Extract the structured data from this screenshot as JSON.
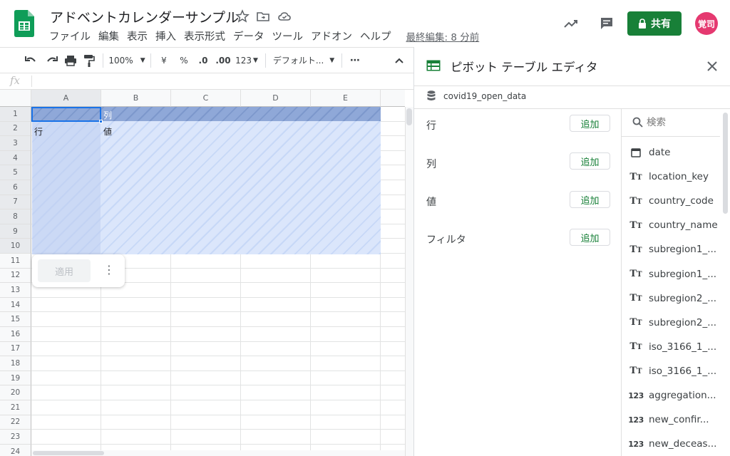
{
  "header": {
    "doc_title": "アドベントカレンダーサンプル",
    "menu": [
      "ファイル",
      "編集",
      "表示",
      "挿入",
      "表示形式",
      "データ",
      "ツール",
      "アドオン",
      "ヘルプ"
    ],
    "last_edit": "最終編集: 8 分前",
    "share_label": "共有",
    "avatar_text": "覚司"
  },
  "toolbar": {
    "zoom": "100%",
    "currency": "¥",
    "percent": "%",
    "dec_less": ".0",
    "dec_more": ".00",
    "format_123": "123",
    "font": "デフォルト..."
  },
  "grid": {
    "columns": [
      "A",
      "B",
      "C",
      "D",
      "E"
    ],
    "rows": [
      "1",
      "2",
      "3",
      "4",
      "5",
      "6",
      "7",
      "8",
      "9",
      "10",
      "11",
      "12",
      "13",
      "14",
      "15",
      "16",
      "17",
      "18",
      "19",
      "20",
      "21",
      "22",
      "23",
      "24"
    ],
    "cell_b1": "列",
    "cell_a2": "行",
    "cell_b2": "値",
    "apply_label": "適用"
  },
  "panel": {
    "title": "ピボット テーブル エディタ",
    "data_source": "covid19_open_data",
    "sections": [
      {
        "label": "行",
        "button": "追加"
      },
      {
        "label": "列",
        "button": "追加"
      },
      {
        "label": "値",
        "button": "追加"
      },
      {
        "label": "フィルタ",
        "button": "追加"
      }
    ],
    "search_placeholder": "検索",
    "fields": [
      {
        "icon": "calendar-icon",
        "label": "date"
      },
      {
        "icon": "text-type-icon",
        "label": "location_key"
      },
      {
        "icon": "text-type-icon",
        "label": "country_code"
      },
      {
        "icon": "text-type-icon",
        "label": "country_name"
      },
      {
        "icon": "text-type-icon",
        "label": "subregion1_..."
      },
      {
        "icon": "text-type-icon",
        "label": "subregion1_..."
      },
      {
        "icon": "text-type-icon",
        "label": "subregion2_..."
      },
      {
        "icon": "text-type-icon",
        "label": "subregion2_..."
      },
      {
        "icon": "text-type-icon",
        "label": "iso_3166_1_..."
      },
      {
        "icon": "text-type-icon",
        "label": "iso_3166_1_..."
      },
      {
        "icon": "number-type-icon",
        "label": "aggregation..."
      },
      {
        "icon": "number-type-icon",
        "label": "new_confir..."
      },
      {
        "icon": "number-type-icon",
        "label": "new_deceas..."
      }
    ]
  },
  "colors": {
    "brand_green": "#188038",
    "avatar_pink": "#e53970",
    "pivot_fill": "#dbe6fb",
    "pivot_header": "#8fa8d8"
  }
}
